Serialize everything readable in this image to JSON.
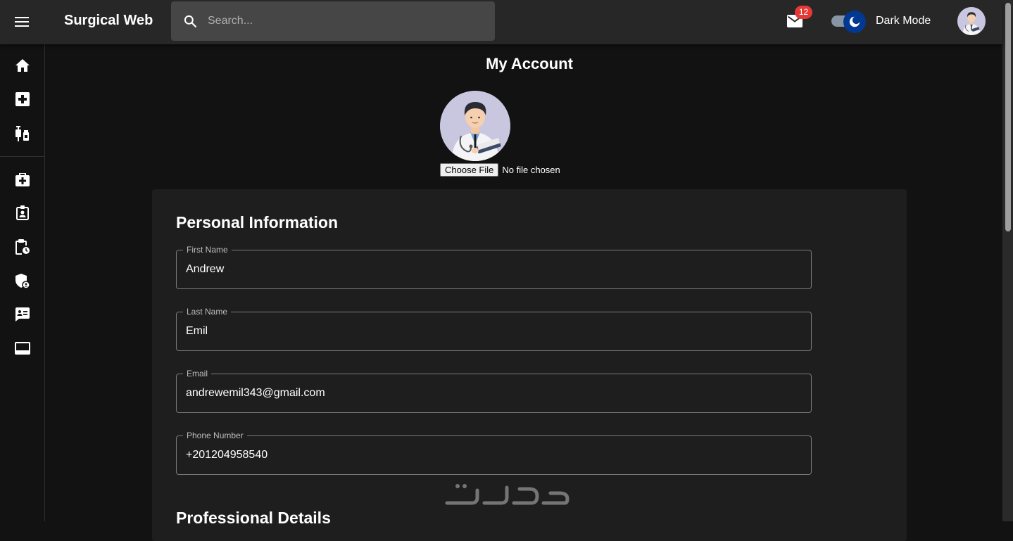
{
  "appbar": {
    "title": "Surgical Web",
    "search_placeholder": "Search...",
    "mail_badge": "12",
    "dark_mode_label": "Dark Mode",
    "icons": [
      "menu-icon",
      "search-icon",
      "mail-icon",
      "moon-icon"
    ]
  },
  "sidebar": {
    "items": [
      {
        "name": "home",
        "icon": "home-icon"
      },
      {
        "name": "medical-plus",
        "icon": "medical-plus-icon"
      },
      {
        "name": "vaccines",
        "icon": "vaccines-icon"
      },
      {
        "name": "medical-kit",
        "icon": "medical-kit-icon"
      },
      {
        "name": "badge",
        "icon": "badge-icon"
      },
      {
        "name": "pending-actions",
        "icon": "pending-actions-icon"
      },
      {
        "name": "admin-shield",
        "icon": "admin-shield-icon"
      },
      {
        "name": "contact-mail",
        "icon": "contact-mail-icon"
      },
      {
        "name": "dashboard-bar",
        "icon": "dashboard-bar-icon"
      }
    ]
  },
  "main": {
    "title": "My Account",
    "file_button": "Choose File",
    "file_status": "No file chosen",
    "sections": [
      {
        "title": "Personal Information"
      },
      {
        "title": "Professional Details"
      }
    ],
    "fields": [
      {
        "label": "First Name",
        "value": "Andrew"
      },
      {
        "label": "Last Name",
        "value": "Emil"
      },
      {
        "label": "Email",
        "value": "andrewemil343@gmail.com"
      },
      {
        "label": "Phone Number",
        "value": "+201204958540"
      }
    ]
  },
  "colors": {
    "background": "#121212",
    "appbar": "#272727",
    "card": "#1e1e1e",
    "badge": "#e53935",
    "toggle_thumb": "#003892"
  }
}
